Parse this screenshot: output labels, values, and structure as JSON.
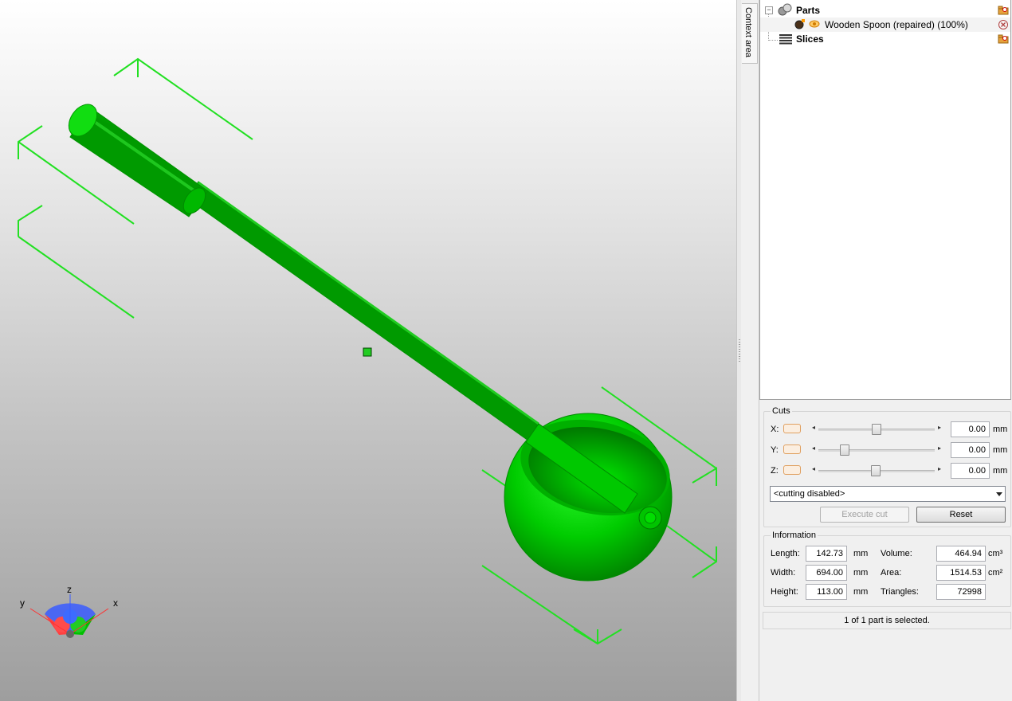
{
  "viewport": {
    "model_color": "#00d400",
    "bracket_color": "#22e022",
    "axes_gizmo": {
      "x_label": "x",
      "y_label": "y",
      "z_label": "z"
    }
  },
  "context_tab": {
    "label": "Context area"
  },
  "tree": {
    "items": [
      {
        "label": "Parts",
        "icon": "parts-icon"
      },
      {
        "label": "Wooden Spoon (repaired) (100%)",
        "icon": "part-icon"
      },
      {
        "label": "Slices",
        "icon": "slices-icon"
      }
    ]
  },
  "cuts": {
    "title": "Cuts",
    "axes": [
      {
        "label": "X:",
        "value": "0.00",
        "unit": "mm",
        "slider_position": 0.5
      },
      {
        "label": "Y:",
        "value": "0.00",
        "unit": "mm",
        "slider_position": 0.2
      },
      {
        "label": "Z:",
        "value": "0.00",
        "unit": "mm",
        "slider_position": 0.49
      }
    ],
    "mode": "<cutting disabled>",
    "execute_label": "Execute cut",
    "reset_label": "Reset"
  },
  "information": {
    "title": "Information",
    "length": {
      "label": "Length:",
      "value": "142.73",
      "unit": "mm"
    },
    "width": {
      "label": "Width:",
      "value": "694.00",
      "unit": "mm"
    },
    "height": {
      "label": "Height:",
      "value": "113.00",
      "unit": "mm"
    },
    "volume": {
      "label": "Volume:",
      "value": "464.94",
      "unit": "cm³"
    },
    "area": {
      "label": "Area:",
      "value": "1514.53",
      "unit": "cm²"
    },
    "triangles": {
      "label": "Triangles:",
      "value": "72998"
    }
  },
  "status": "1 of 1 part is selected."
}
